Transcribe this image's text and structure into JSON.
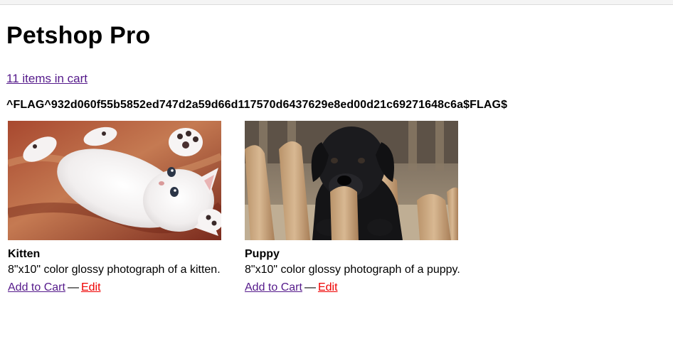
{
  "header": {
    "title": "Petshop Pro",
    "cart_link": "11 items in cart",
    "flag_text": "^FLAG^932d060f55b5852ed747d2a59d66d117570d6437629e8ed00d21c69271648c6a$FLAG$"
  },
  "products": [
    {
      "name": "Kitten",
      "description": "8\"x10\" color glossy photograph of a kitten.",
      "add_label": "Add to Cart",
      "separator": "—",
      "edit_label": "Edit",
      "image": "kitten-photo"
    },
    {
      "name": "Puppy",
      "description": "8\"x10\" color glossy photograph of a puppy.",
      "add_label": "Add to Cart",
      "separator": "—",
      "edit_label": "Edit",
      "image": "puppy-photo"
    }
  ],
  "colors": {
    "link_visited": "#551a8b",
    "edit_link": "#ee0000",
    "text": "#000000"
  }
}
